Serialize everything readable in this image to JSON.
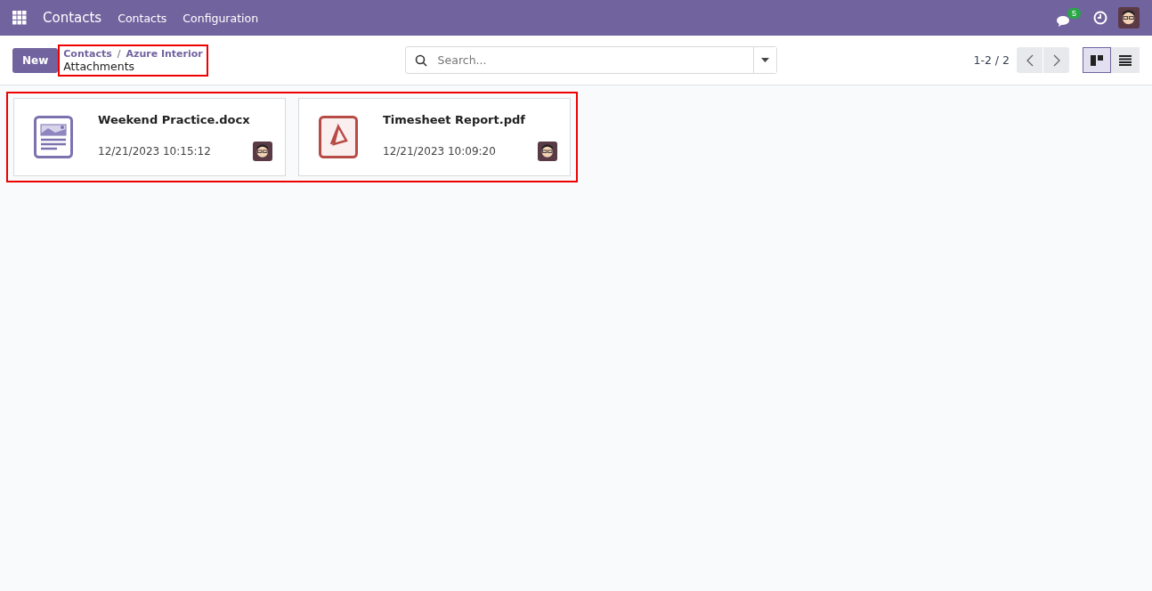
{
  "navbar": {
    "app_title": "Contacts",
    "menu": [
      "Contacts",
      "Configuration"
    ],
    "message_count": "5"
  },
  "control_panel": {
    "new_button": "New",
    "breadcrumbs": [
      "Contacts",
      "Azure Interior"
    ],
    "breadcrumb_separator": "/",
    "title": "Attachments",
    "search": {
      "placeholder": "Search..."
    },
    "pager": "1-2 / 2",
    "views": [
      {
        "kind": "kanban",
        "selected": true
      },
      {
        "kind": "list",
        "selected": false
      }
    ]
  },
  "attachments": [
    {
      "name": "Weekend Practice.docx",
      "date": "12/21/2023 10:15:12",
      "kind": "document"
    },
    {
      "name": "Timesheet Report.pdf",
      "date": "12/21/2023 10:09:20",
      "kind": "pdf"
    }
  ]
}
